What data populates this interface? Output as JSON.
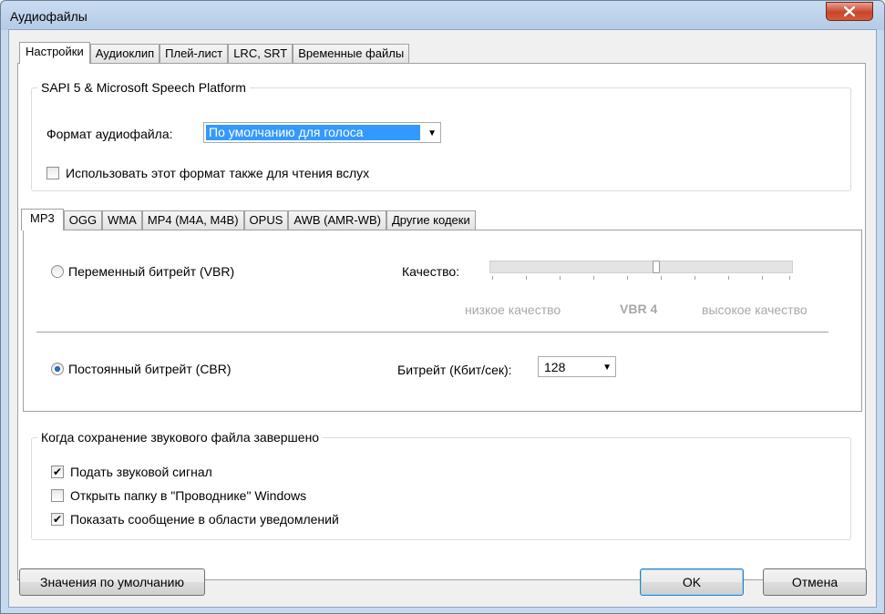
{
  "window": {
    "title": "Аудиофайлы"
  },
  "tabs": [
    "Настройки",
    "Аудиоклип",
    "Плей-лист",
    "LRC, SRT",
    "Временные файлы"
  ],
  "sapi": {
    "legend": "SAPI 5 & Microsoft Speech Platform",
    "format_label": "Формат аудиофайла:",
    "format_value": "По умолчанию для голоса",
    "use_for_reading_label": "Использовать этот формат также для чтения вслух",
    "use_for_reading_checked": false
  },
  "codec_tabs": [
    "MP3",
    "OGG",
    "WMA",
    "MP4 (M4A, M4B)",
    "OPUS",
    "AWB (AMR-WB)",
    "Другие кодеки"
  ],
  "mp3": {
    "vbr_label": "Переменный битрейт (VBR)",
    "vbr_selected": false,
    "quality_label": "Качество:",
    "quality_low": "низкое качество",
    "quality_current": "VBR 4",
    "quality_high": "высокое качество",
    "quality_level": 0.55,
    "cbr_label": "Постоянный битрейт (CBR)",
    "cbr_selected": true,
    "bitrate_label": "Битрейт (Кбит/сек):",
    "bitrate_value": "128"
  },
  "on_complete": {
    "legend": "Когда сохранение звукового файла завершено",
    "items": [
      {
        "label": "Подать звуковой сигнал",
        "checked": true
      },
      {
        "label": "Открыть папку в \"Проводнике\" Windows",
        "checked": false
      },
      {
        "label": "Показать сообщение в области уведомлений",
        "checked": true
      }
    ]
  },
  "buttons": {
    "defaults": "Значения по умолчанию",
    "ok": "OK",
    "cancel": "Отмена"
  },
  "icons": {
    "close": "close-icon",
    "dropdown": "chevron-down-icon",
    "check": "check-icon"
  },
  "colors": {
    "selection": "#3399ff",
    "close": "#c7462b"
  }
}
